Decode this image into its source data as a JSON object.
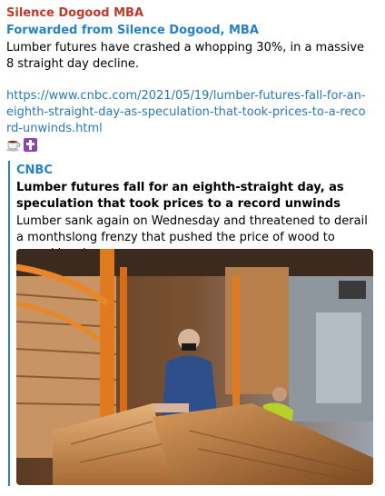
{
  "message": {
    "sender": "Silence Dogood MBA",
    "forwarded_from": "Forwarded from Silence Dogood, MBA",
    "text": "Lumber futures have crashed a whopping 30%, in a massive 8 straight day decline.",
    "link": "https://www.cnbc.com/2021/05/19/lumber-futures-fall-for-an-eighth-straight-day-as-speculation-that-took-prices-to-a-record-unwinds.html",
    "emojis": [
      "coffee-icon",
      "latin-cross-icon"
    ]
  },
  "preview": {
    "site_name": "CNBC",
    "title": "Lumber futures fall for an eighth-straight day, as speculation that took prices to a record unwinds",
    "description": "Lumber sank again on Wednesday and threatened to derail a monthslong frenzy that pushed the price of wood to record levels.",
    "image": "lumber-store-photo",
    "accent_color": "#2481cc"
  },
  "colors": {
    "sender": "#c0392b",
    "forwarded": "#2481cc",
    "link": "#2a7ab0"
  }
}
